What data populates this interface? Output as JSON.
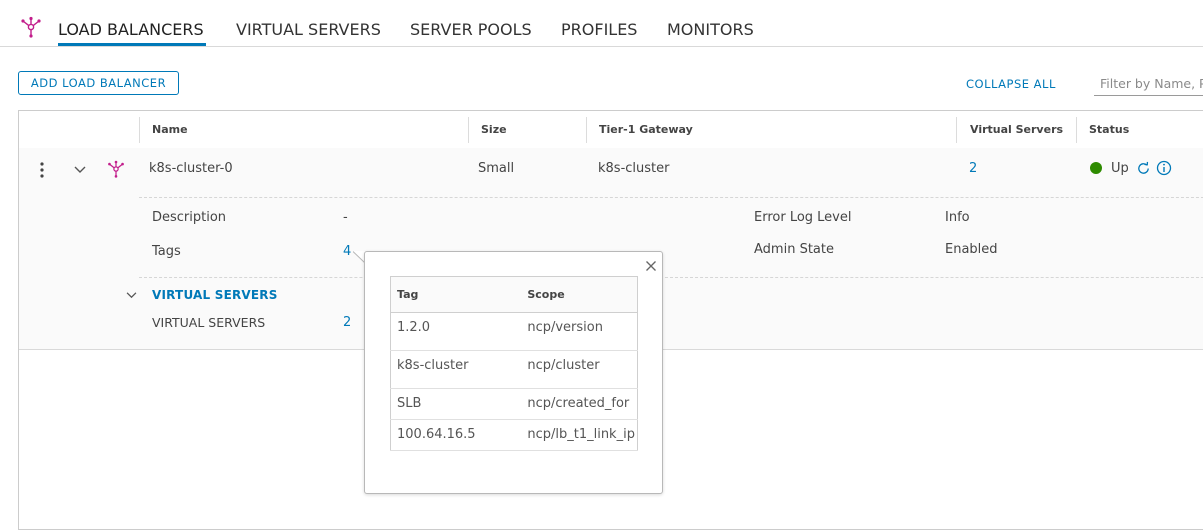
{
  "nav": {
    "logo_icon": "load-balancer-icon",
    "tabs": [
      {
        "label": "LOAD BALANCERS",
        "active": true
      },
      {
        "label": "VIRTUAL SERVERS",
        "active": false
      },
      {
        "label": "SERVER POOLS",
        "active": false
      },
      {
        "label": "PROFILES",
        "active": false
      },
      {
        "label": "MONITORS",
        "active": false
      }
    ]
  },
  "toolbar": {
    "add_label": "ADD LOAD BALANCER",
    "collapse_all_label": "COLLAPSE ALL",
    "filter_placeholder": "Filter by Name, Path and more"
  },
  "grid": {
    "columns": [
      "Name",
      "Size",
      "Tier-1 Gateway",
      "Virtual Servers",
      "Status"
    ],
    "row": {
      "name": "k8s-cluster-0",
      "size": "Small",
      "tier1_gateway": "k8s-cluster",
      "virtual_servers": "2",
      "status": "Up",
      "status_color": "#2e8b00"
    },
    "details": {
      "description_label": "Description",
      "description_value": "-",
      "tags_label": "Tags",
      "tags_value": "4",
      "error_log_label": "Error Log Level",
      "error_log_value": "Info",
      "admin_state_label": "Admin State",
      "admin_state_value": "Enabled",
      "vs_section_title": "VIRTUAL SERVERS",
      "vs_label": "VIRTUAL SERVERS",
      "vs_value": "2"
    }
  },
  "tags_popover": {
    "headers": [
      "Tag",
      "Scope"
    ],
    "rows": [
      {
        "tag": "1.2.0",
        "scope": "ncp/version"
      },
      {
        "tag": "k8s-cluster",
        "scope": "ncp/cluster"
      },
      {
        "tag": "SLB",
        "scope": "ncp/created_for"
      },
      {
        "tag": "100.64.16.5",
        "scope": "ncp/lb_t1_link_ip"
      }
    ]
  },
  "colors": {
    "accent": "#0079b8",
    "logo": "#c21d8b",
    "status_up": "#2e8b00"
  }
}
